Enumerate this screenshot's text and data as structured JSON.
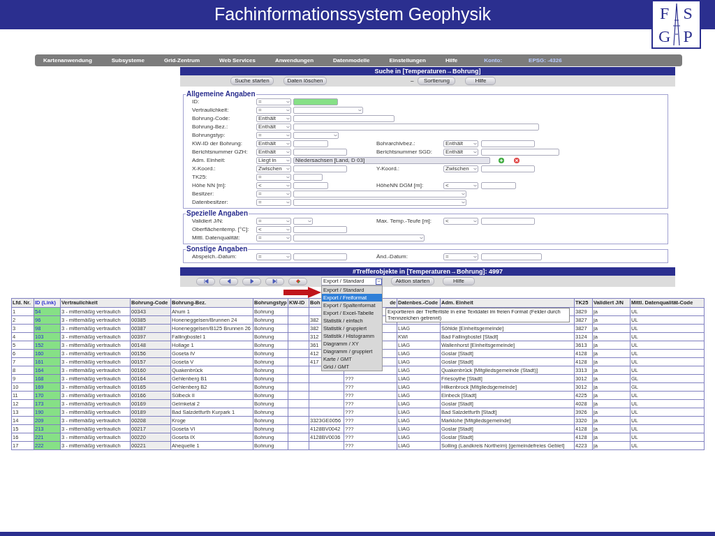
{
  "slide": {
    "title": "Fachinformationssystem Geophysik",
    "logo": [
      "F",
      "S",
      "G",
      "P"
    ]
  },
  "menu": [
    {
      "label": "Kartenanwendung",
      "kind": "item"
    },
    {
      "label": "Subsysteme",
      "kind": "item"
    },
    {
      "label": "Grid-Zentrum",
      "kind": "item"
    },
    {
      "label": "Web Services",
      "kind": "item"
    },
    {
      "label": "Anwendungen",
      "kind": "item"
    },
    {
      "label": "Datenmodelle",
      "kind": "item"
    },
    {
      "label": "Einstellungen",
      "kind": "item"
    },
    {
      "label": "Hilfe",
      "kind": "item"
    },
    {
      "label": "Konto:",
      "kind": "info"
    },
    {
      "label": "EPSG: -4326",
      "kind": "info"
    }
  ],
  "search": {
    "title": "Suche in [Temperaturen→Bohrung]",
    "buttons": [
      "Suche starten",
      "Daten löschen"
    ],
    "separator": "–",
    "buttons_right": [
      "Sortierung",
      "Hilfe"
    ]
  },
  "fieldsets": [
    {
      "legend": "Allgemeine Angaben",
      "rows": [
        {
          "label": "ID:",
          "operator": "=",
          "value": {
            "kind": "text",
            "highlighted": true
          }
        },
        {
          "label": "Vertraulichkeit:",
          "operator": "=",
          "value": {
            "kind": "select",
            "highlighted": false
          }
        },
        {
          "label": "Bohrung-Code:",
          "operator": "Enthält",
          "value": {
            "kind": "text",
            "highlighted": false
          }
        },
        {
          "label": "Bohrung-Bez.:",
          "operator": "Enthält",
          "value": {
            "kind": "text",
            "highlighted": false
          }
        },
        {
          "label": "Bohrungstyp:",
          "operator": "=",
          "value": {
            "kind": "select",
            "highlighted": false
          }
        },
        {
          "label": "KW-ID der Bohrung:",
          "operator": "Enthält",
          "value": {
            "kind": "text",
            "highlighted": false
          },
          "right": {
            "label": "Bohrarchivbez.:",
            "operator": "Enthält",
            "value": {
              "kind": "text",
              "highlighted": false
            }
          }
        },
        {
          "label": "Berichtsnummer GZH:",
          "operator": "Enthält",
          "value": {
            "kind": "text",
            "highlighted": false
          },
          "right": {
            "label": "Berichtsnummer SGD:",
            "operator": "Enthält",
            "value": {
              "kind": "text",
              "highlighted": false
            }
          }
        },
        {
          "label": "Adm. Einheit:",
          "operator": "Liegt in",
          "value": {
            "kind": "text",
            "highlighted": false,
            "text": "Niedersachsen [Land, D 03]"
          }
        },
        {
          "label": "X-Koord.:",
          "operator": "Zwischen",
          "value": {
            "kind": "text",
            "highlighted": false
          },
          "right": {
            "label": "Y-Koord.:",
            "operator": "Zwischen",
            "value": {
              "kind": "text",
              "highlighted": false
            }
          }
        },
        {
          "label": "TK25:",
          "operator": "=",
          "value": {
            "kind": "text",
            "highlighted": false
          }
        },
        {
          "label": "Höhe NN [m]:",
          "operator": "<",
          "value": {
            "kind": "text",
            "highlighted": false
          },
          "right": {
            "label": "HöheNN DGM [m]:",
            "operator": "<",
            "value": {
              "kind": "text",
              "highlighted": false
            }
          }
        },
        {
          "label": "Besitzer:",
          "operator": "=",
          "value": {
            "kind": "select",
            "highlighted": false
          }
        },
        {
          "label": "Datenbesitzer:",
          "operator": "=",
          "value": {
            "kind": "select",
            "highlighted": false
          }
        }
      ]
    },
    {
      "legend": "Spezielle Angaben",
      "rows": [
        {
          "label": "Validiert J/N:",
          "operator": "=",
          "value": {
            "kind": "select",
            "highlighted": false
          },
          "right": {
            "label": "Max. Temp.-Teufe [m]:",
            "operator": "<",
            "value": {
              "kind": "text",
              "highlighted": false
            }
          }
        },
        {
          "label": "Oberflächentemp. [°C]:",
          "operator": "<",
          "value": {
            "kind": "text",
            "highlighted": false
          }
        },
        {
          "label": "Mittl. Datenqualität:",
          "operator": "=",
          "value": {
            "kind": "select",
            "highlighted": false
          }
        }
      ]
    },
    {
      "legend": "Sonstige Angaben",
      "rows": [
        {
          "label": "Abspeich.-Datum:",
          "operator": "=",
          "value": {
            "kind": "text",
            "highlighted": false
          },
          "right": {
            "label": "Änd.-Datum:",
            "operator": "=",
            "value": {
              "kind": "text",
              "highlighted": false
            }
          }
        }
      ]
    }
  ],
  "results": {
    "title": "#Trefferobjekte in [Temperaturen→Bohrung]: 4997",
    "action_select": "Export / Standard",
    "buttons": [
      "Aktion starten",
      "Hilfe"
    ],
    "menu": [
      {
        "label": "Export / Standard",
        "selected": false
      },
      {
        "label": "Export / Freiformat",
        "selected": true
      },
      {
        "label": "Export / Spaltenformat",
        "selected": false
      },
      {
        "label": "Export / Excel-Tabelle",
        "selected": false
      },
      {
        "label": "Statistik / einfach",
        "selected": false
      },
      {
        "label": "Statistik / gruppiert",
        "selected": false
      },
      {
        "label": "Statistik / Histogramm",
        "selected": false
      },
      {
        "label": "Diagramm / XY",
        "selected": false
      },
      {
        "label": "Diagramm / gruppiert",
        "selected": false
      },
      {
        "label": "Karte / GMT",
        "selected": false
      },
      {
        "label": "Grid / GMT",
        "selected": false
      }
    ],
    "tooltip": "Exportieren der Trefferliste in eine Textdatei im freien Format (Felder durch Trennzeichen getrennt)",
    "columns": [
      "Lfd. Nr.",
      "ID (Link)",
      "Vertraulichkeit",
      "Bohrung-Code",
      "Bohrung-Bez.",
      "Bohrungstyp",
      "KW-ID",
      "Boh",
      "de",
      "Datenbes.-Code",
      "Adm. Einheit",
      "TK25",
      "Validiert J/N",
      "Mittl. Datenqualität-Code"
    ],
    "rows": [
      [
        "1",
        "54",
        "3 - mittemäßig vertraulich",
        "00343",
        "Ahum 1",
        "Bohrung",
        null,
        null,
        null,
        null,
        null,
        "3829",
        "ja",
        "UL"
      ],
      [
        "2",
        "96",
        "3 - mittemäßig vertraulich",
        "00385",
        "Honeneggelsen/Brunnen 24",
        "Bohrung",
        null,
        "382",
        null,
        null,
        null,
        "3827",
        "ja",
        "UL"
      ],
      [
        "3",
        "98",
        "3 - mittemäßig vertraulich",
        "00387",
        "Honeneggelsen/B125 Brunnen 26",
        "Bohrung",
        null,
        "382",
        null,
        "LIAG",
        "Söhlde [Einheitsgemeinde]",
        "3827",
        "ja",
        "UL"
      ],
      [
        "4",
        "103",
        "3 - mittemäßig vertraulich",
        "00397",
        "Fallingbostel 1",
        "Bohrung",
        null,
        "312",
        null,
        "KWI",
        "Bad Fallingbostel [Stadt]",
        "3124",
        "ja",
        "UL"
      ],
      [
        "5",
        "152",
        "3 - mittemäßig vertraulich",
        "00148",
        "Hollage 1",
        "Bohrung",
        null,
        "361",
        null,
        "LIAG",
        "Wallenhorst [Einheitsgemeinde]",
        "3613",
        "ja",
        "UL"
      ],
      [
        "6",
        "160",
        "3 - mittemäßig vertraulich",
        "00156",
        "Goseta IV",
        "Bohrung",
        null,
        "412",
        null,
        "LIAG",
        "Goslar [Stadt]",
        "4128",
        "ja",
        "UL"
      ],
      [
        "7",
        "161",
        "3 - mittemäßig vertraulich",
        "00157",
        "Goseta V",
        "Bohrung",
        null,
        "417",
        null,
        "LIAG",
        "Goslar [Stadt]",
        "4128",
        "ja",
        "UL"
      ],
      [
        "8",
        "164",
        "3 - mittemäßig vertraulich",
        "00160",
        "Quakenbrück",
        "Bohrung",
        null,
        null,
        null,
        "LIAG",
        "Quakenbrück [Mitgliedsgemeinde (Stadt)]",
        "3313",
        "ja",
        "UL"
      ],
      [
        "9",
        "168",
        "3 - mittemäßig vertraulich",
        "00164",
        "Gehlenberg B1",
        "Bohrung",
        null,
        null,
        "???",
        "LIAG",
        "Friesoythe [Stadt]",
        "3012",
        "ja",
        "GL"
      ],
      [
        "10",
        "169",
        "3 - mittemäßig vertraulich",
        "00165",
        "Gehlenberg B2",
        "Bohrung",
        null,
        null,
        "???",
        "LIAG",
        "Hilkenbrock [Mitgliedsgemeinde]",
        "3012",
        "ja",
        "GL"
      ],
      [
        "11",
        "170",
        "3 - mittemäßig vertraulich",
        "00166",
        "Sülbeck II",
        "Bohrung",
        null,
        null,
        "???",
        "LIAG",
        "Einbeck [Stadt]",
        "4225",
        "ja",
        "UL"
      ],
      [
        "12",
        "173",
        "3 - mittemäßig vertraulich",
        "00169",
        "Gelmketal 2",
        "Bohrung",
        null,
        null,
        "???",
        "LIAG",
        "Goslar [Stadt]",
        "4028",
        "ja",
        "UL"
      ],
      [
        "13",
        "190",
        "3 - mittemäßig vertraulich",
        "00189",
        "Bad Salzdetfurth Kurpark 1",
        "Bohrung",
        null,
        null,
        "???",
        "LIAG",
        "Bad Salzdetfurth [Stadt]",
        "3926",
        "ja",
        "UL"
      ],
      [
        "14",
        "209",
        "3 - mittemäßig vertraulich",
        "00208",
        "Kroge",
        "Bohrung",
        null,
        "3323GE0056",
        "???",
        "LIAG",
        "Marklohe [Mitgliedsgemeinde]",
        "3320",
        "ja",
        "UL"
      ],
      [
        "15",
        "213",
        "3 - mittemäßig vertraulich",
        "00217",
        "Goseta VI",
        "Bohrung",
        null,
        "4128BV0042",
        "???",
        "LIAG",
        "Goslar [Stadt]",
        "4128",
        "ja",
        "UL"
      ],
      [
        "16",
        "221",
        "3 - mittemäßig vertraulich",
        "00220",
        "Goseta IX",
        "Bohrung",
        null,
        "4128BV0036",
        "???",
        "LIAG",
        "Goslar [Stadt]",
        "4128",
        "ja",
        "UL"
      ],
      [
        "17",
        "222",
        "3 - mittemäßig vertraulich",
        "00221",
        "Ahequelle 1",
        "Bohrung",
        null,
        null,
        "???",
        "LIAG",
        "Solling (Landkreis Northeim) [gemeindefreies Gebiet]",
        "4223",
        "ja",
        "UL"
      ]
    ]
  }
}
